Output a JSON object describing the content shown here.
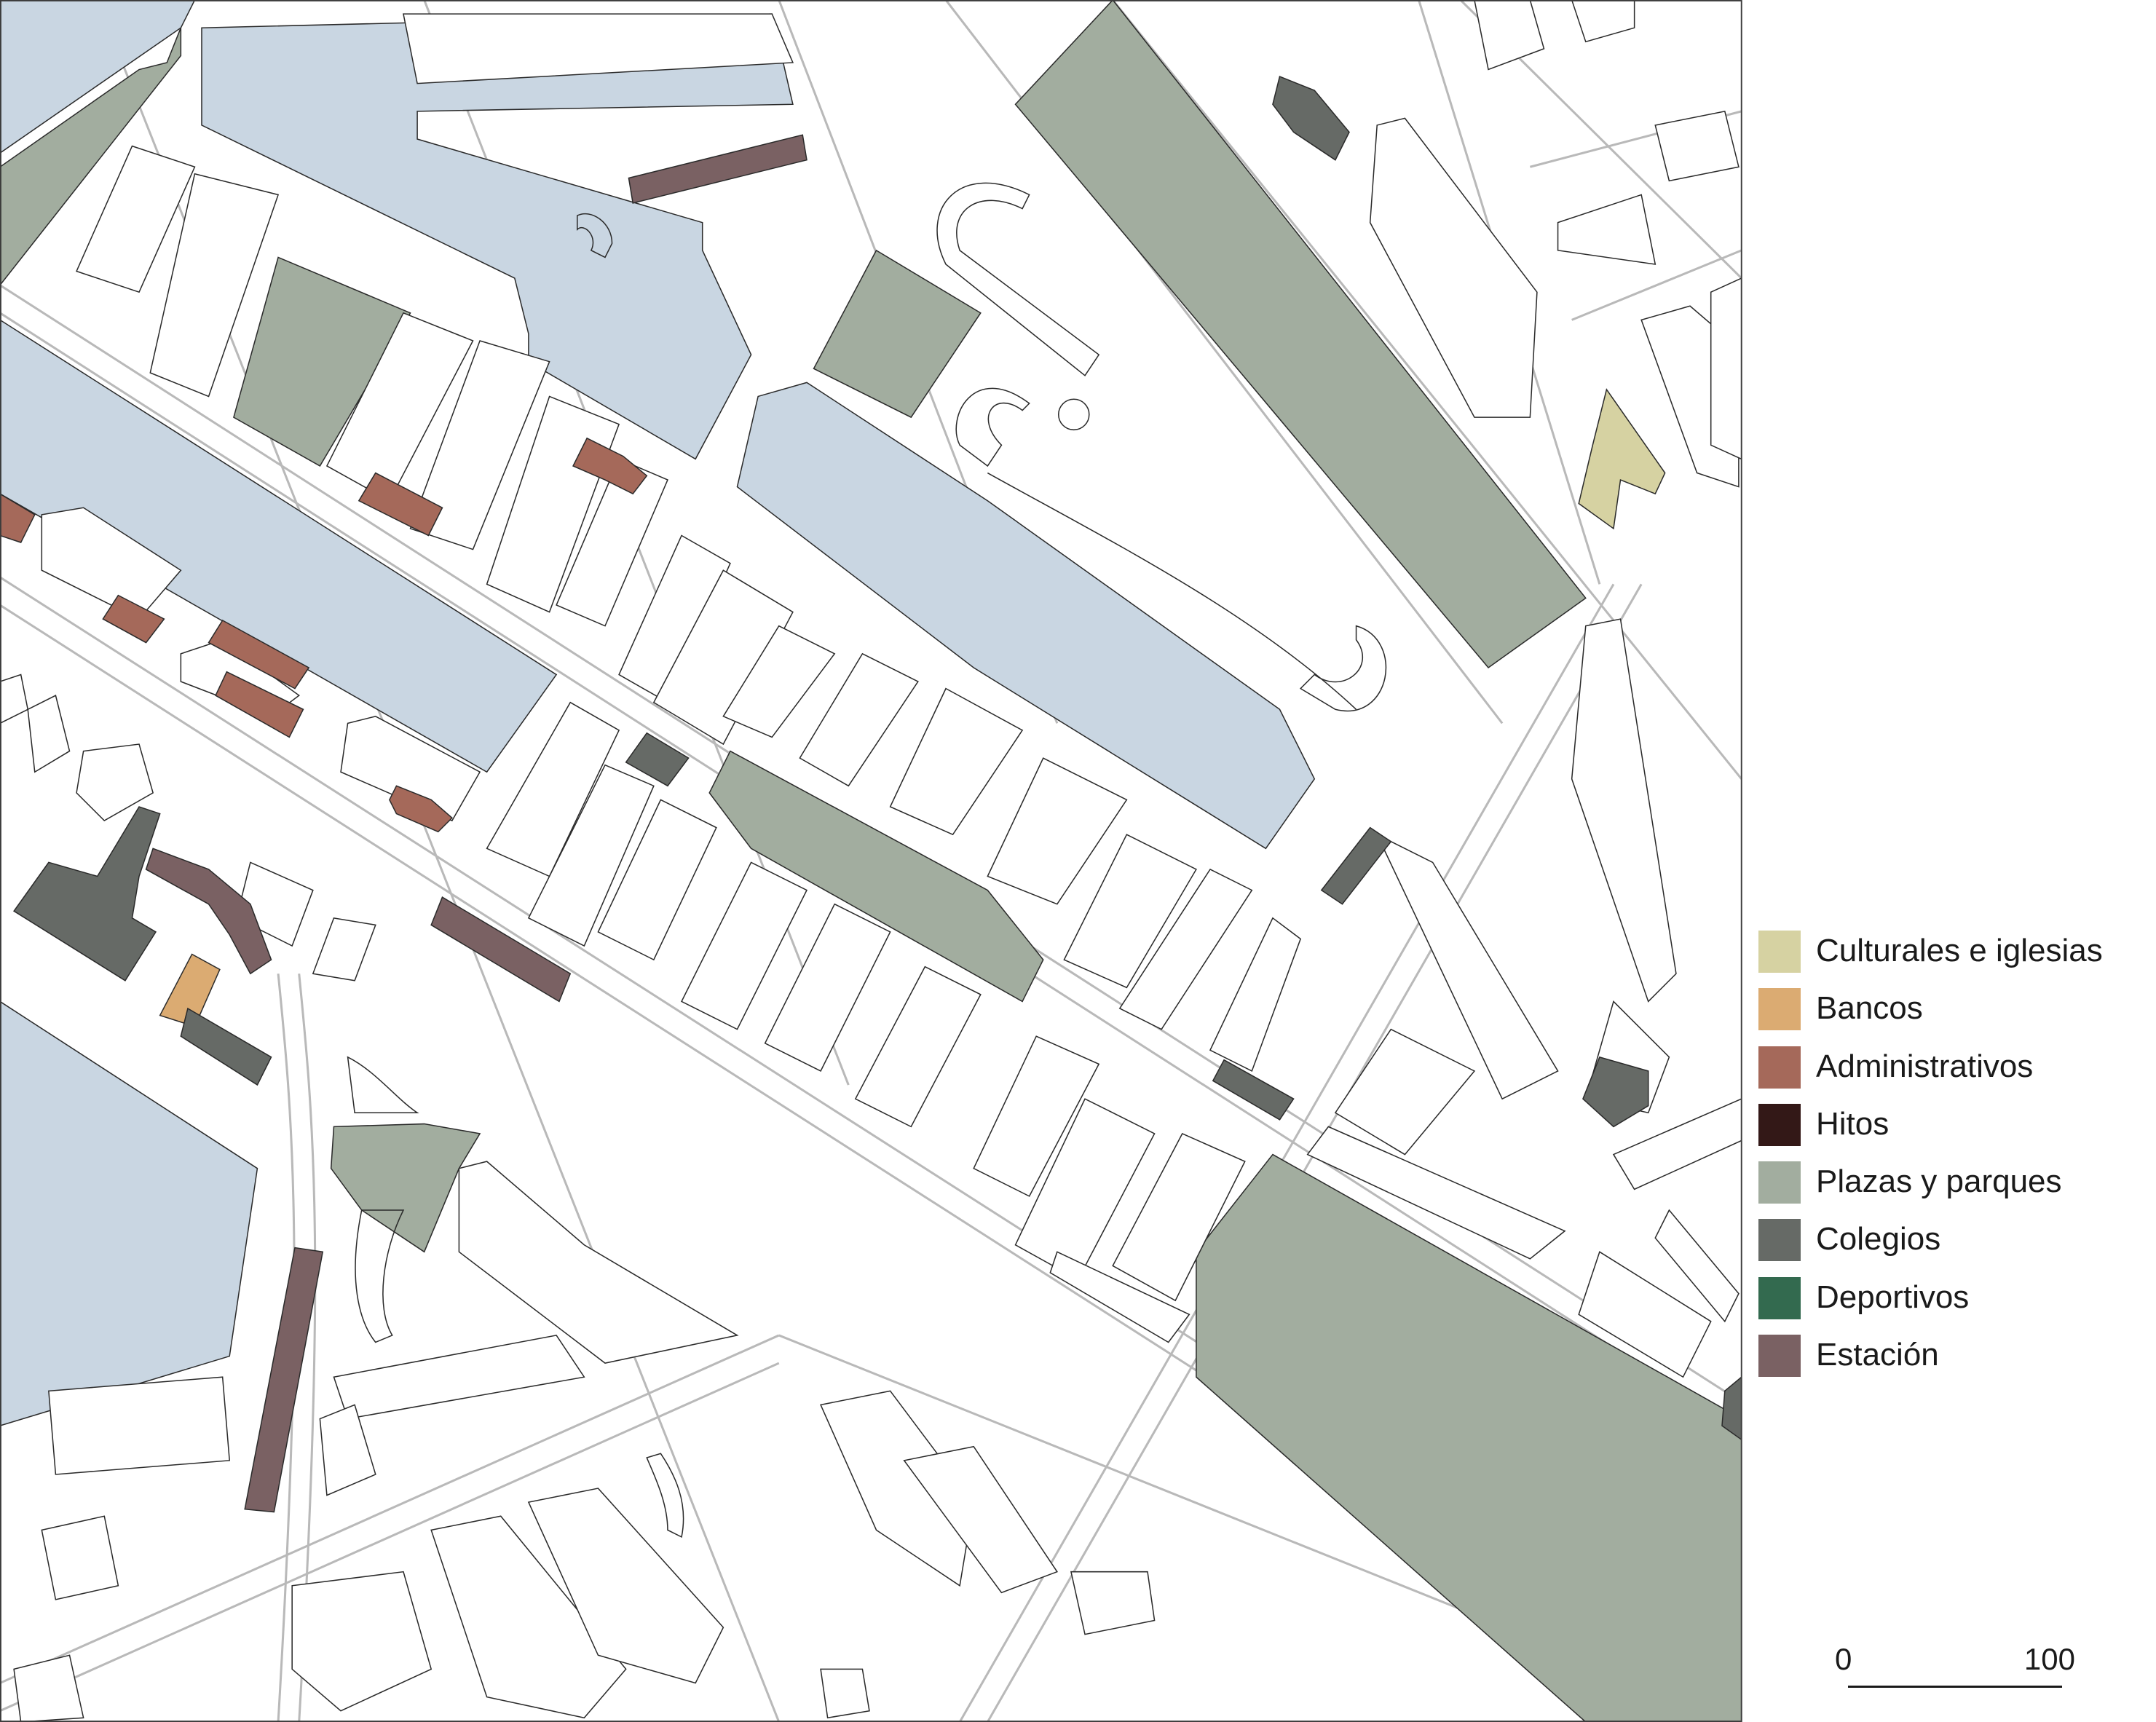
{
  "colors": {
    "water": "#c9d6e2",
    "parks": "#a2ad9f",
    "schools": "#666a66",
    "station": "#7a6163",
    "administrative": "#a5695a",
    "banks": "#dbab72",
    "culture": "#d6d2a2",
    "landmarks": "#331817",
    "sports": "#336a4f",
    "block_stroke": "#2b2b2b",
    "street": "#b9b9b9"
  },
  "legend": {
    "items": [
      {
        "label": "Culturales e iglesias",
        "color": "#d6d2a2"
      },
      {
        "label": "Bancos",
        "color": "#dbab72"
      },
      {
        "label": "Administrativos",
        "color": "#a5695a"
      },
      {
        "label": "Hitos",
        "color": "#331817"
      },
      {
        "label": "Plazas y parques",
        "color": "#a2ad9f"
      },
      {
        "label": "Colegios",
        "color": "#666a66"
      },
      {
        "label": "Deportivos",
        "color": "#336a4f"
      },
      {
        "label": "Estación",
        "color": "#7a6163"
      }
    ]
  },
  "scale": {
    "min_label": "0",
    "max_label": "100"
  }
}
